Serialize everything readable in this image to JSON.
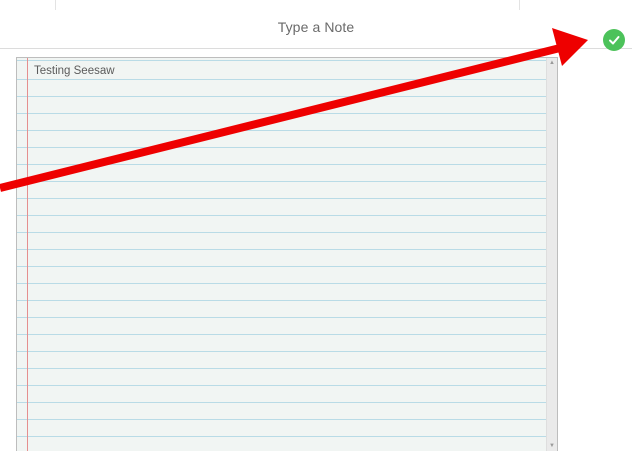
{
  "header": {
    "title": "Type a Note",
    "done_icon": "checkmark-circle-icon",
    "done_color": "#4cc25a"
  },
  "note": {
    "text": "Testing Seesaw",
    "line_color": "#b9dbe6",
    "margin_color": "#e58f8f",
    "paper_color": "#f1f5f3"
  },
  "scrollbar": {
    "up_icon": "scroll-up-arrow-icon",
    "down_icon": "scroll-down-arrow-icon"
  },
  "annotation": {
    "icon": "red-arrow-annotation",
    "color": "#ee0000"
  }
}
